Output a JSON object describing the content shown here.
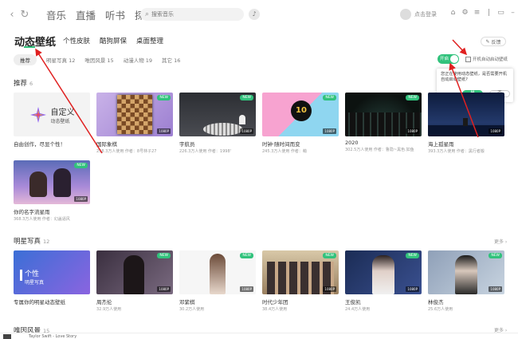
{
  "topbar": {
    "back": "‹",
    "refresh": "↻",
    "nav": [
      "音乐",
      "直播",
      "听书",
      "探索"
    ],
    "search_placeholder": "搜索音乐",
    "login": "点击登录"
  },
  "header": {
    "title": "动态壁纸",
    "tabs": [
      "个性皮肤",
      "酷狗屏保",
      "桌面整理"
    ],
    "feedback": "反馈"
  },
  "categories": [
    "推荐",
    "明星写真 12",
    "唯因风景 15",
    "动漫人物 19",
    "其它 16"
  ],
  "toggle": {
    "label": "开启",
    "checkbox_label": "开机自动启动壁纸"
  },
  "popup": {
    "message": "您正在使用动态壁纸，是否需要开机自动启动壁纸?",
    "yes": "是",
    "no": "否"
  },
  "sections": {
    "recommend": {
      "title": "推荐",
      "count": "6",
      "cards": [
        {
          "name": "自由创作，尽显个性！",
          "users": "",
          "t1": "自定义",
          "t2": "动态壁纸"
        },
        {
          "name": "国际象棋",
          "users": "258.3万人使用  作者：8号林子27",
          "res": "1080P"
        },
        {
          "name": "宇航员",
          "users": "226.3万人使用  作者：1998'",
          "res": "1080P"
        },
        {
          "name": "时钟·随时间而变",
          "users": "245.3万人使用  作者：萌",
          "res": "1080P"
        },
        {
          "name": "2020",
          "users": "302.5万人使用  作者：鲁隐~黑色.如鱼",
          "res": "1080P"
        },
        {
          "name": "海上孤星雨",
          "users": "393.3万人使用  作者：黑行者搬",
          "res": "1080P"
        },
        {
          "name": "你的名字流星雨",
          "users": "368.3万人使用  作者：幻盖逼风",
          "res": "1080P"
        }
      ]
    },
    "stars": {
      "title": "明星写真",
      "count": "12",
      "more": "更多 ›",
      "cards": [
        {
          "name": "专属你的明星动态壁纸",
          "users": "",
          "t1": "个性",
          "t2": "明星写真"
        },
        {
          "name": "周杰伦",
          "users": "32.9万人使用",
          "res": "1080P"
        },
        {
          "name": "邓紫棋",
          "users": "30.2万人使用",
          "res": "1080P"
        },
        {
          "name": "时代少年团",
          "users": "38.4万人使用",
          "res": "1080P"
        },
        {
          "name": "王俊凯",
          "users": "24.4万人使用",
          "res": "1080P"
        },
        {
          "name": "林俊杰",
          "users": "25.6万人使用",
          "res": "1080P"
        }
      ]
    },
    "next": {
      "title": "唯因风景",
      "count": "15",
      "more": "更多 ›"
    }
  },
  "badges": {
    "new": "NEW"
  },
  "player": {
    "now_playing": "Taylor Swift - Love Story"
  },
  "colors": {
    "accent": "#31c27c"
  }
}
